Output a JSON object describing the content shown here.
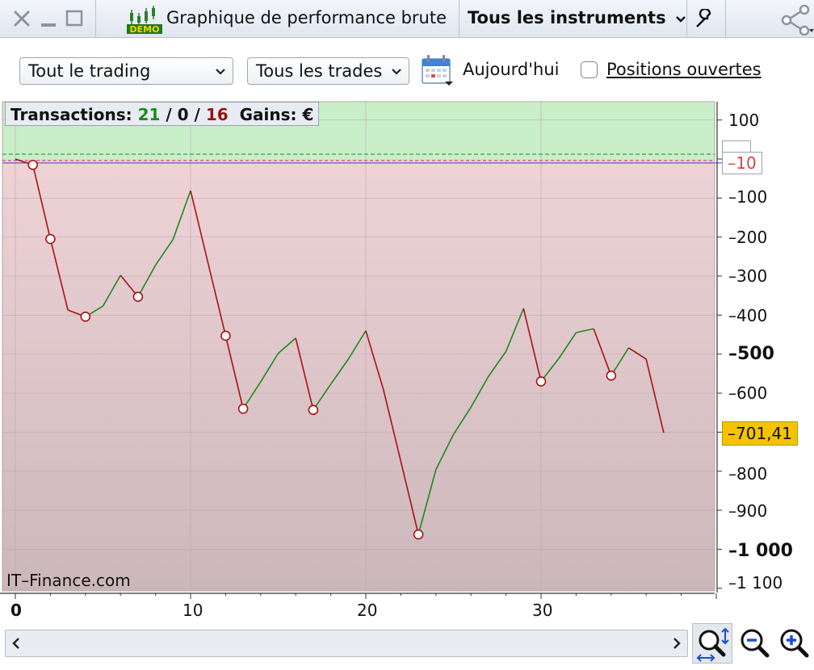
{
  "window": {
    "title": "Graphique de performance brute",
    "demo_badge": "DEMO",
    "instrument_selector": "Tous les instruments"
  },
  "toolbar": {
    "scope_select": "Tout le trading",
    "trades_select": "Tous les trades",
    "today_label": "Aujourd'hui",
    "open_positions_label": "Positions ouvertes",
    "open_positions_checked": false
  },
  "stats": {
    "label": "Transactions:",
    "wins": "21",
    "sep1": " / ",
    "neutral": "0",
    "sep2": " / ",
    "losses": "16",
    "gains_label": "Gains: €"
  },
  "watermark": "IT–Finance.com",
  "badges": {
    "last_value": "–701,41",
    "reference_value": "–10"
  },
  "colors": {
    "up": "#1b8a1b",
    "down": "#a61212",
    "profit_zone": "#c9efc9",
    "loss_zone": "#dcc3c7",
    "last_badge": "#f3c300"
  },
  "chart_data": {
    "type": "line",
    "title": "",
    "xlabel": "",
    "ylabel": "",
    "xlim": [
      -0.5,
      40
    ],
    "ylim": [
      -1130,
      125
    ],
    "zero_line": 0,
    "reference_line": -10,
    "x_ticks": [
      "0",
      "10",
      "20",
      "30"
    ],
    "y_ticks": [
      "100",
      "–100",
      "–200",
      "–300",
      "–400",
      "–500",
      "–600",
      "–800",
      "–900",
      "–1 000",
      "–1 100"
    ],
    "points": [
      {
        "x": 0,
        "y": 0
      },
      {
        "x": 1,
        "y": -15
      },
      {
        "x": 2,
        "y": -205
      },
      {
        "x": 3,
        "y": -387
      },
      {
        "x": 4,
        "y": -404
      },
      {
        "x": 5,
        "y": -377
      },
      {
        "x": 6,
        "y": -298
      },
      {
        "x": 7,
        "y": -353
      },
      {
        "x": 8,
        "y": -272
      },
      {
        "x": 9,
        "y": -206
      },
      {
        "x": 10,
        "y": -81
      },
      {
        "x": 11,
        "y": -267
      },
      {
        "x": 12,
        "y": -453
      },
      {
        "x": 13,
        "y": -640
      },
      {
        "x": 14,
        "y": -571
      },
      {
        "x": 15,
        "y": -498
      },
      {
        "x": 16,
        "y": -459
      },
      {
        "x": 17,
        "y": -643
      },
      {
        "x": 18,
        "y": -577
      },
      {
        "x": 19,
        "y": -513
      },
      {
        "x": 20,
        "y": -440
      },
      {
        "x": 21,
        "y": -590
      },
      {
        "x": 22,
        "y": -775
      },
      {
        "x": 23,
        "y": -962
      },
      {
        "x": 24,
        "y": -796
      },
      {
        "x": 25,
        "y": -706
      },
      {
        "x": 26,
        "y": -636
      },
      {
        "x": 27,
        "y": -557
      },
      {
        "x": 28,
        "y": -493
      },
      {
        "x": 29,
        "y": -383
      },
      {
        "x": 30,
        "y": -570
      },
      {
        "x": 31,
        "y": -512
      },
      {
        "x": 32,
        "y": -445
      },
      {
        "x": 33,
        "y": -435
      },
      {
        "x": 34,
        "y": -555
      },
      {
        "x": 35,
        "y": -484
      },
      {
        "x": 36,
        "y": -513
      },
      {
        "x": 37,
        "y": -701.41
      }
    ],
    "last_value": -701.41
  }
}
